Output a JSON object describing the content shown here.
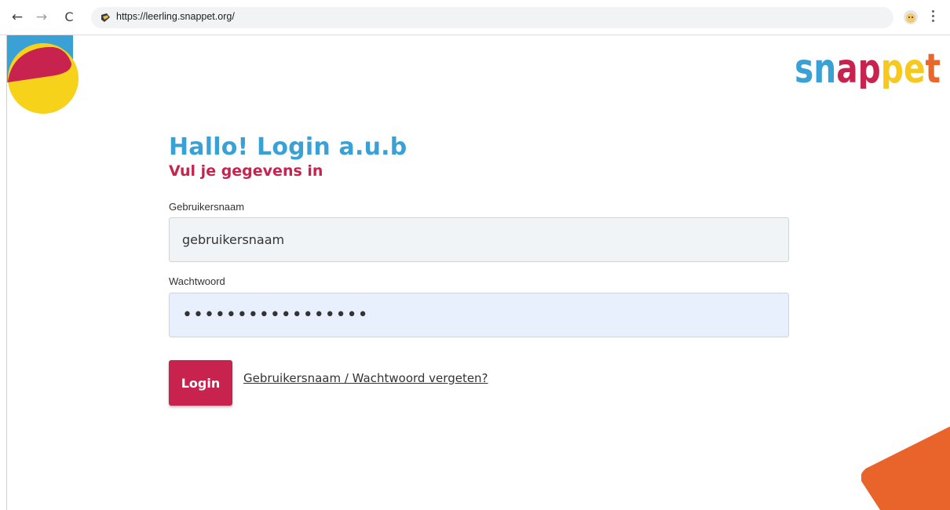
{
  "browser": {
    "url": "https://leerling.snappet.org/",
    "back_icon": "arrow-left-icon",
    "forward_icon": "arrow-right-icon",
    "reload_icon": "reload-icon",
    "back_glyph": "←",
    "forward_glyph": "→",
    "reload_glyph": "C"
  },
  "logo": {
    "letters": [
      "s",
      "n",
      "a",
      "p",
      "p",
      "e",
      "t"
    ],
    "colors": [
      "#3aa1d6",
      "#3aa1d6",
      "#c8234f",
      "#c8234f",
      "#f7c81e",
      "#f7c81e",
      "#e8672a"
    ]
  },
  "login": {
    "title": "Hallo! Login a.u.b",
    "subtitle": "Vul je gegevens in",
    "username_label": "Gebruikersnaam",
    "username_value": "gebruikersnaam",
    "password_label": "Wachtwoord",
    "password_value": "fakepassword12345",
    "submit_label": "Login",
    "forgot_link": "Gebruikersnaam / Wachtwoord vergeten?"
  },
  "colors": {
    "blue": "#3aa1d6",
    "red": "#c8234f",
    "yellow": "#f7d21a",
    "orange": "#e8642a"
  }
}
